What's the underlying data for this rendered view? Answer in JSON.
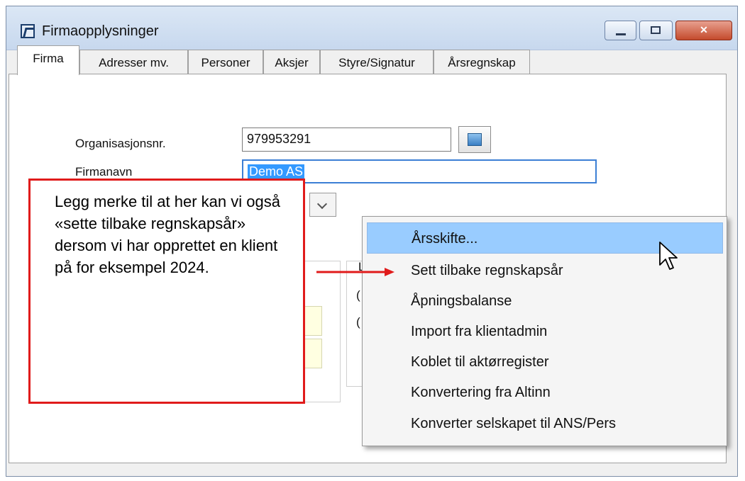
{
  "window": {
    "title": "Firmaopplysninger",
    "controls": [
      "minimize",
      "maximize",
      "close"
    ]
  },
  "tabs": [
    {
      "label": "Firma",
      "active": true
    },
    {
      "label": "Adresser mv.",
      "active": false
    },
    {
      "label": "Personer",
      "active": false
    },
    {
      "label": "Aksjer",
      "active": false
    },
    {
      "label": "Styre/Signatur",
      "active": false
    },
    {
      "label": "Årsregnskap",
      "active": false
    }
  ],
  "form": {
    "orgnr_label": "Organisasjonsnr.",
    "orgnr_value": "979953291",
    "firmanavn_label": "Firmanavn",
    "firmanavn_value": "Demo AS",
    "fragments": [
      "L",
      "(",
      "("
    ]
  },
  "callout": {
    "text": "Legg merke til at her kan vi også «sette tilbake regnskapsår» dersom vi har opprettet en klient på for eksempel 2024.",
    "border_color": "#e01b1b"
  },
  "context_menu": {
    "highlight_color": "#99ccff",
    "items": [
      {
        "label": "Årsskifte...",
        "highlighted": true
      },
      {
        "label": "Sett tilbake regnskapsår",
        "highlighted": false
      },
      {
        "label": "Åpningsbalanse",
        "highlighted": false
      },
      {
        "label": "Import fra klientadmin",
        "highlighted": false
      },
      {
        "label": "Koblet til aktørregister",
        "highlighted": false
      },
      {
        "label": "Konvertering fra Altinn",
        "highlighted": false
      },
      {
        "label": "Konverter selskapet til ANS/Pers",
        "highlighted": false
      }
    ]
  },
  "icons": {
    "app": "app-icon",
    "lookup": "lookup-icon",
    "cursor": "mouse-pointer-icon"
  }
}
